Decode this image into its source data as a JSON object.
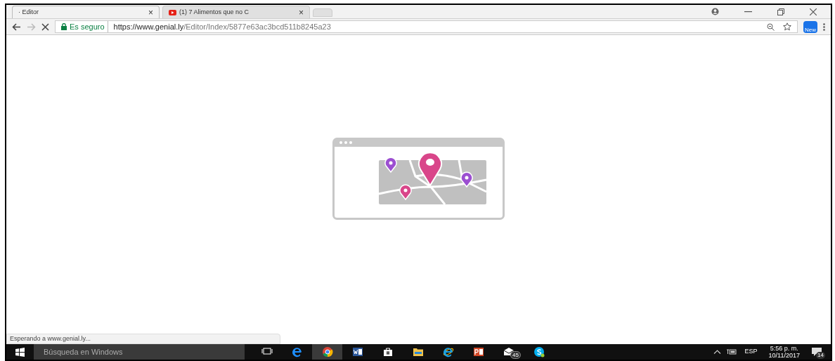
{
  "tabs": [
    {
      "title": "· Editor",
      "close": "×",
      "selected": true,
      "kind": "page"
    },
    {
      "title": "(1) 7 Alimentos que no C",
      "close": "×",
      "selected": false,
      "kind": "video"
    }
  ],
  "address_bar": {
    "security": "Es seguro",
    "url_host": "https://www.genial.ly",
    "url_path": "/Editor/Index/5877e63ac3bcd511b8245a23"
  },
  "extension_badge": "New",
  "status_bubble": "Esperando a www.genial.ly...",
  "taskbar": {
    "search_placeholder": "Búsqueda en Windows",
    "apps": [
      {
        "kind": "task-view",
        "active": false
      },
      {
        "kind": "edge",
        "active": false
      },
      {
        "kind": "chrome",
        "active": true
      },
      {
        "kind": "word",
        "active": false
      },
      {
        "kind": "store",
        "active": false
      },
      {
        "kind": "explorer",
        "active": false
      },
      {
        "kind": "ie",
        "active": false
      },
      {
        "kind": "powerpoint",
        "active": false
      },
      {
        "kind": "mail",
        "active": false,
        "badge": "45"
      },
      {
        "kind": "skype",
        "active": false
      }
    ],
    "language": "ESP",
    "time": "5:56 p. m.",
    "date": "10/11/2017",
    "notifications": "14"
  }
}
